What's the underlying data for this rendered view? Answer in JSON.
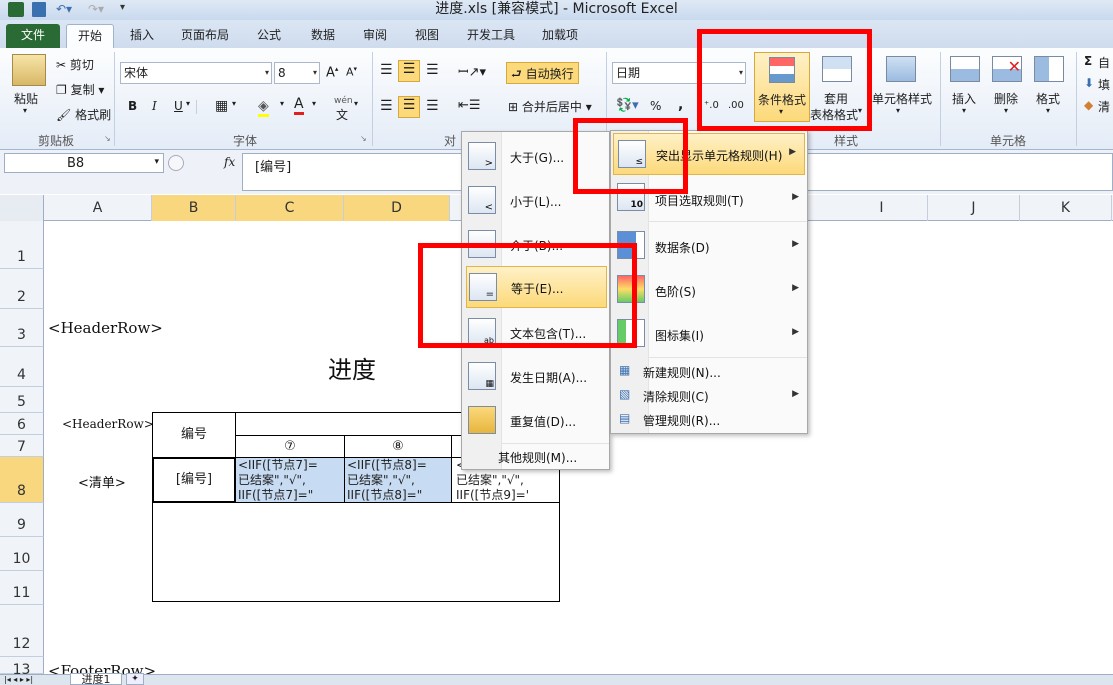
{
  "window": {
    "title": "进度.xls  [兼容模式] - Microsoft Excel"
  },
  "tabs": [
    "文件",
    "开始",
    "插入",
    "页面布局",
    "公式",
    "数据",
    "审阅",
    "视图",
    "开发工具",
    "加载项"
  ],
  "clipboard": {
    "paste": "粘贴",
    "cut": "剪切",
    "copy": "复制",
    "format_painter": "格式刷",
    "group": "剪贴板"
  },
  "font": {
    "name": "宋体",
    "size": "8",
    "bold": "B",
    "italic": "I",
    "underline": "U",
    "wen": "wén",
    "group": "字体"
  },
  "alignment": {
    "wrap": "自动换行",
    "merge": "合并后居中",
    "group": "对"
  },
  "number": {
    "format": "日期",
    "percent": "%",
    "comma": ","
  },
  "styles": {
    "cond_format": "条件格式",
    "table_format_1": "套用",
    "table_format_2": "表格格式",
    "cell_style": "单元格样式",
    "group": "样式"
  },
  "cells": {
    "insert": "插入",
    "delete": "删除",
    "format": "格式",
    "group": "单元格"
  },
  "editing": {
    "sum": "Σ",
    "a": "自",
    "b": "填",
    "c": "清"
  },
  "formula_bar": {
    "name_box": "B8",
    "fx": "fx",
    "content": "[编号]"
  },
  "columns": [
    "A",
    "B",
    "C",
    "D",
    "I",
    "J",
    "K"
  ],
  "rows": [
    "1",
    "2",
    "3",
    "4",
    "5",
    "6",
    "7",
    "8",
    "9",
    "10",
    "11",
    "12",
    "13"
  ],
  "sheet": {
    "header_row_a3": "<HeaderRow>",
    "title": "进度",
    "header_row_a6": "<HeaderRow>",
    "list_a8": "<清单>",
    "bianhao": "编号",
    "circle7": "⑦",
    "circle8": "⑧",
    "b8": "[编号]",
    "c8_l1": "<IIF([节点7]=",
    "c8_l2": "已结案\",\"√\",",
    "c8_l3": "IIF([节点7]=\"",
    "d8_l1": "<IIF([节点8]=",
    "d8_l2": "已结案\",\"√\",",
    "d8_l3": "IIF([节点8]=\"",
    "e8_l1": "<",
    "e8_l2": "已结案\",\"√\",",
    "e8_l3": "IIF([节点9]='",
    "footer": "<FooterRow>",
    "tab_name": "进度1"
  },
  "menu_left": {
    "items": [
      "大于(G)...",
      "小于(L)...",
      "介于(B)...",
      "等于(E)...",
      "文本包含(T)...",
      "发生日期(A)...",
      "重复值(D)..."
    ],
    "more": "其他规则(M)..."
  },
  "menu_right": {
    "items": [
      "突出显示单元格规则(H)",
      "项目选取规则(T)",
      "数据条(D)",
      "色阶(S)",
      "图标集(I)"
    ],
    "rules": [
      "新建规则(N)...",
      "清除规则(C)",
      "管理规则(R)..."
    ]
  },
  "colors": {
    "highlight": "#fcd97a",
    "selection": "#c7dcf3",
    "annotation": "#ff0000",
    "file_tab": "#2a6a34"
  }
}
